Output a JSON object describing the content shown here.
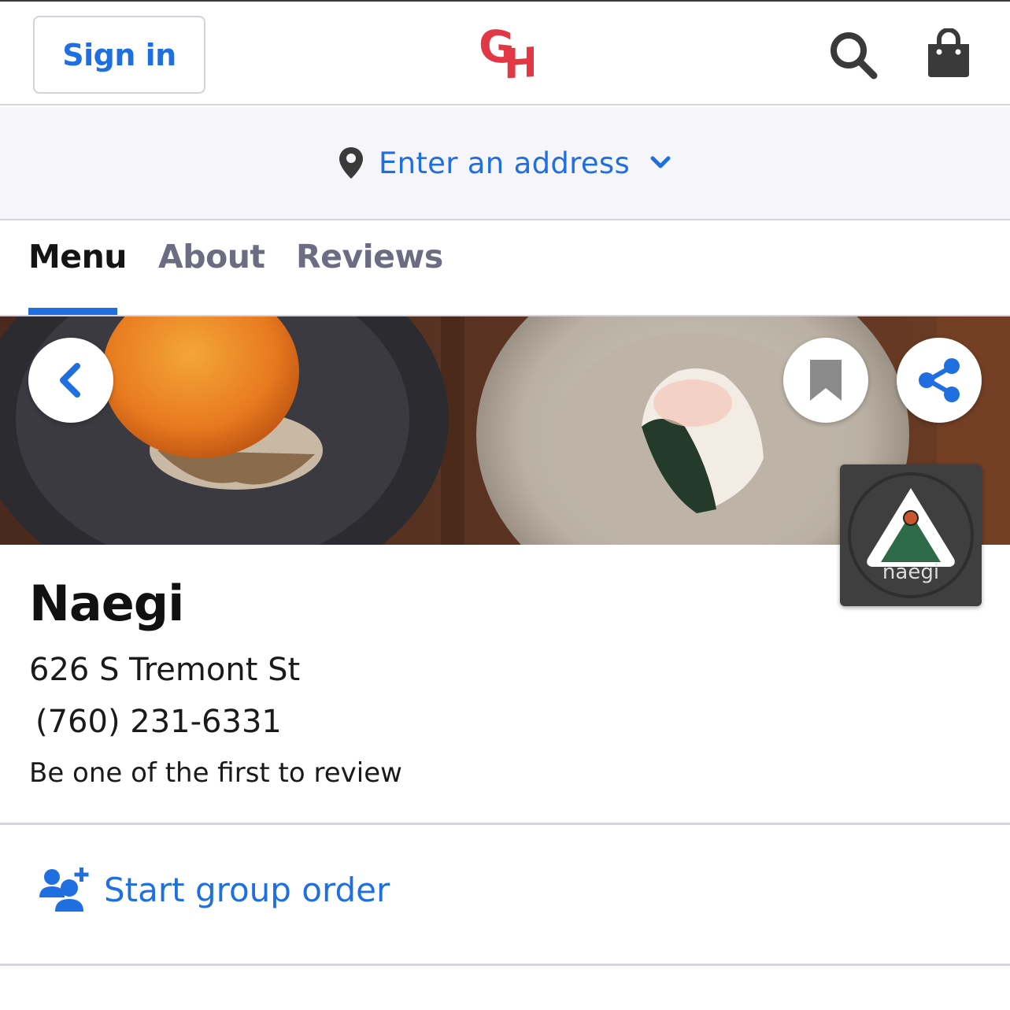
{
  "header": {
    "sign_in_label": "Sign in",
    "logo_text": "GH",
    "search_icon": "search-icon",
    "bag_icon": "shopping-bag-icon"
  },
  "address_bar": {
    "label": "Enter an address",
    "pin_icon": "location-pin-icon",
    "chevron_icon": "chevron-down-icon"
  },
  "tabs": [
    {
      "label": "Menu",
      "active": true
    },
    {
      "label": "About",
      "active": false
    },
    {
      "label": "Reviews",
      "active": false
    }
  ],
  "hero_buttons": {
    "back_icon": "chevron-left-icon",
    "bookmark_icon": "bookmark-icon",
    "share_icon": "share-icon"
  },
  "restaurant": {
    "name": "Naegi",
    "address": "626 S Tremont St",
    "phone": "(760) 231-6331",
    "review_prompt": "Be one of the first to review",
    "logo_text": "naegi"
  },
  "group_order": {
    "label": "Start group order",
    "icon": "add-group-icon"
  },
  "colors": {
    "accent_blue": "#1f6fe0",
    "brand_red": "#e23744",
    "tab_inactive": "#6c6c83"
  }
}
